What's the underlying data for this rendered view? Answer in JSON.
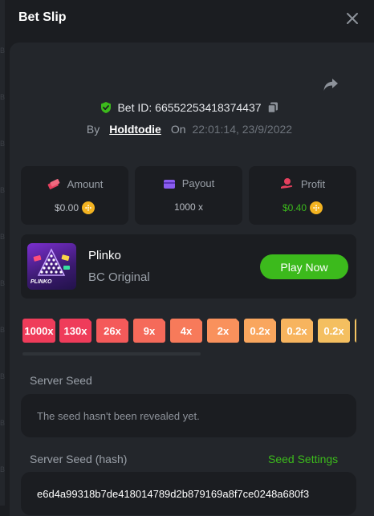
{
  "header": {
    "title": "Bet Slip"
  },
  "bet": {
    "id_label": "Bet ID: 66552253418374437",
    "by_label": "By",
    "user": "Holdtodie",
    "on_label": "On",
    "datetime": "22:01:14, 23/9/2022"
  },
  "stats": [
    {
      "label": "Amount",
      "value": "$0.00",
      "color": "#b8bcc3",
      "icon": "money-stack-icon"
    },
    {
      "label": "Payout",
      "value": "1000 x",
      "color": "#b8bcc3",
      "icon": "wallet-icon"
    },
    {
      "label": "Profit",
      "value": "$0.40",
      "color": "#3cba1c",
      "icon": "hand-money-icon"
    }
  ],
  "game": {
    "name": "Plinko",
    "provider": "BC Original",
    "thumb_text": "PLINKO",
    "play_label": "Play Now"
  },
  "multipliers": [
    "1000x",
    "130x",
    "26x",
    "9x",
    "4x",
    "2x",
    "0.2x",
    "0.2x",
    "0.2x"
  ],
  "multiplier_colors": [
    "#ef3c5a",
    "#ef3c5a",
    "#f45a5a",
    "#f56a5a",
    "#f77a5a",
    "#f9915c",
    "#f9a65e",
    "#f7b45e",
    "#f4bf60"
  ],
  "server_seed": {
    "label": "Server Seed",
    "value": "The seed hasn't been revealed yet."
  },
  "server_seed_hash": {
    "label": "Server Seed (hash)",
    "settings_label": "Seed Settings",
    "value": "e6d4a99318b7de418014789d2b879169a8f7ce0248a680f3"
  },
  "colors": {
    "accent_green": "#3cba1c",
    "coin": "#f3b321",
    "background": "#1b1d21",
    "card": "#23262b"
  }
}
